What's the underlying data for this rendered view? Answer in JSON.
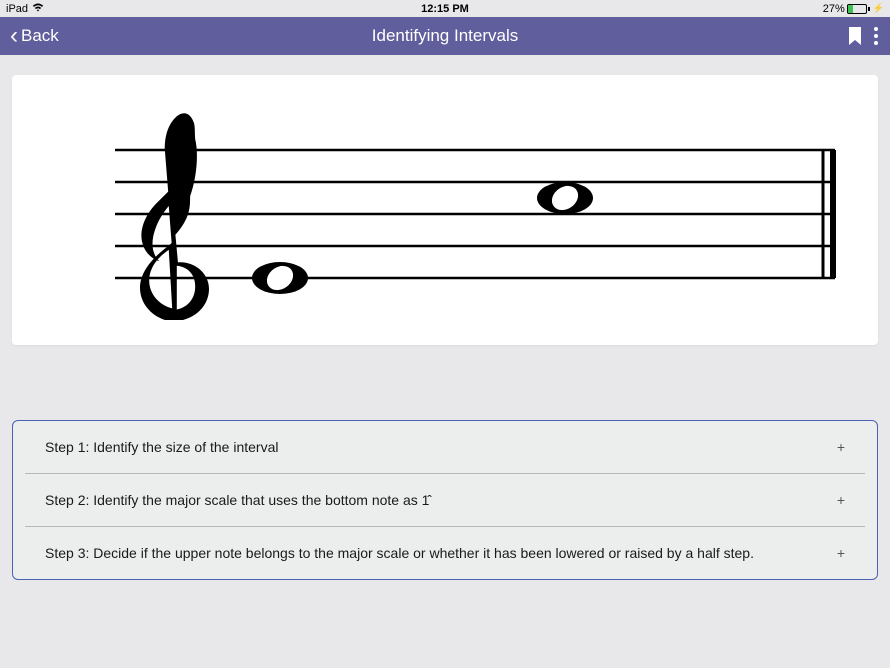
{
  "statusBar": {
    "device": "iPad",
    "time": "12:15 PM",
    "batteryPercent": "27%"
  },
  "navBar": {
    "backLabel": "Back",
    "title": "Identifying Intervals"
  },
  "steps": {
    "items": [
      {
        "text": "Step 1: Identify the size of the interval",
        "expand": "+"
      },
      {
        "text": "Step 2: Identify the major scale that uses the bottom note as 1̂",
        "expand": "+"
      },
      {
        "text": "Step 3: Decide if the upper note belongs to the major scale or whether it has been lowered or raised by a half step.",
        "expand": "+"
      }
    ]
  }
}
